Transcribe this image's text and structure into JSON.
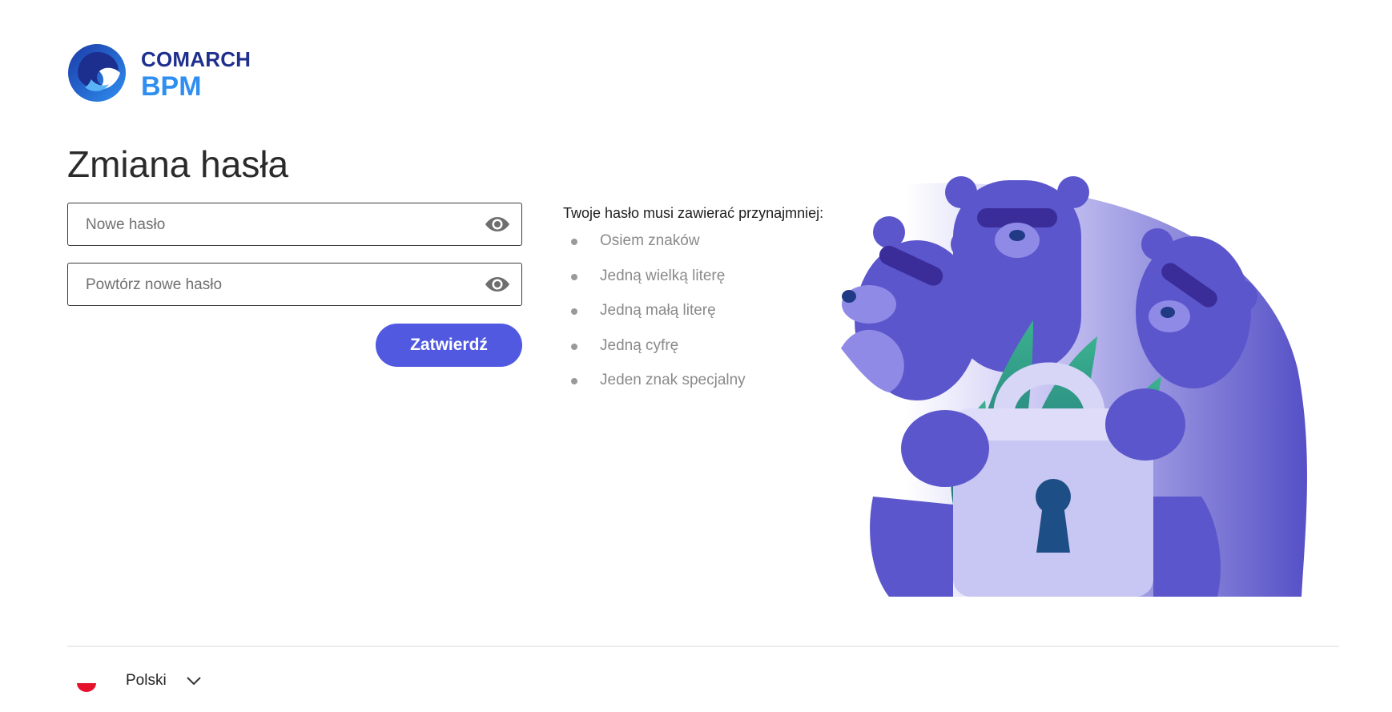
{
  "brand": {
    "name": "COMARCH",
    "product": "BPM"
  },
  "page": {
    "title": "Zmiana hasła"
  },
  "form": {
    "new_password": {
      "placeholder": "Nowe hasło",
      "value": ""
    },
    "repeat_password": {
      "placeholder": "Powtórz nowe hasło",
      "value": ""
    },
    "submit_label": "Zatwierdź"
  },
  "requirements": {
    "title": "Twoje hasło musi zawierać przynajmniej:",
    "items": [
      "Osiem znaków",
      "Jedną wielką literę",
      "Jedną małą literę",
      "Jedną cyfrę",
      "Jeden znak specjalny"
    ]
  },
  "footer": {
    "language": "Polski",
    "flag": "poland-flag-icon",
    "dropdown_icon": "chevron-down-icon"
  },
  "colors": {
    "accent": "#5059e0",
    "brand_dark": "#1f2f8e",
    "brand_light": "#2f8ff0",
    "illustration": "#5a55c8"
  },
  "icons": {
    "show_password": "eye-icon"
  }
}
